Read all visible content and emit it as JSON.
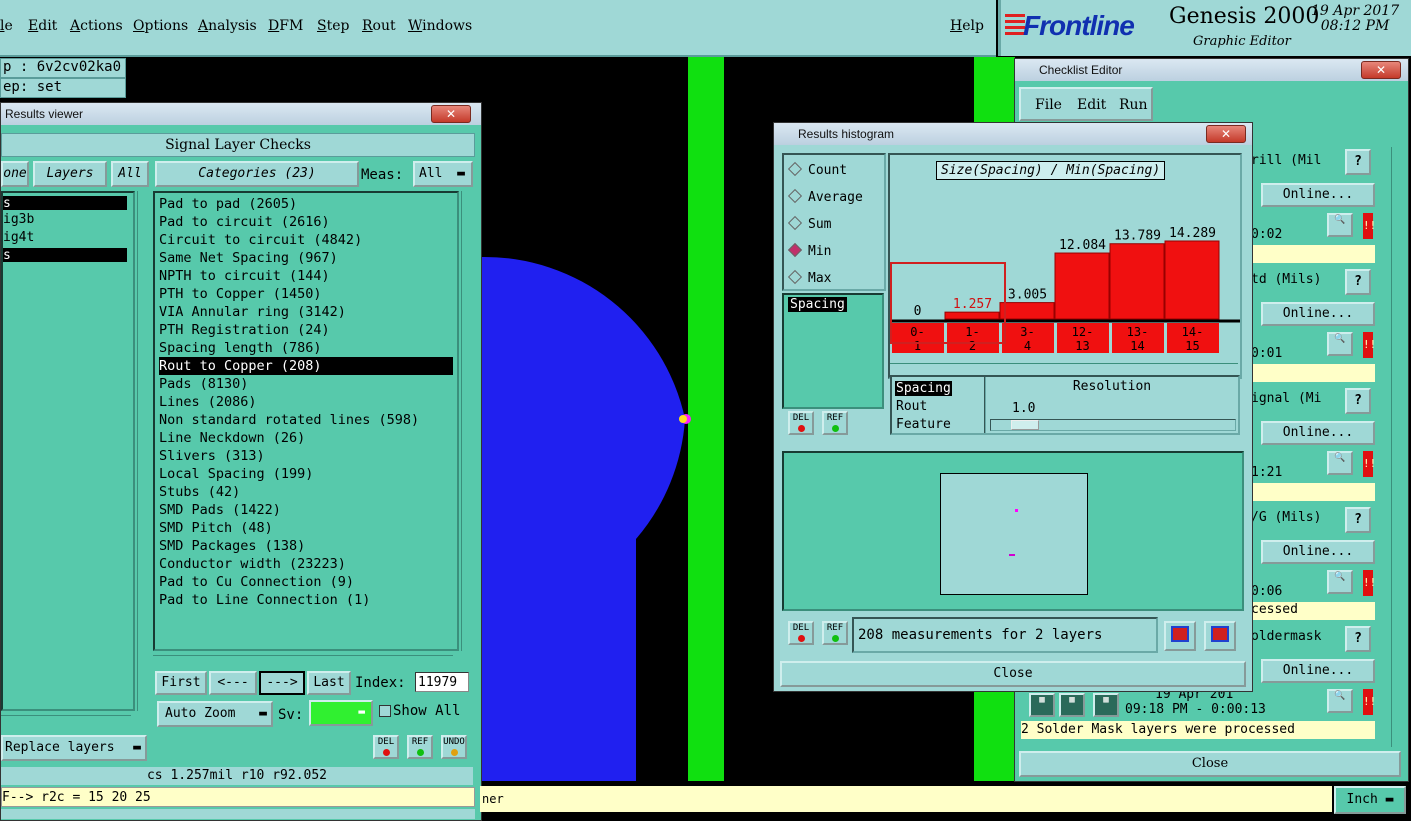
{
  "menu": [
    "le",
    "Edit",
    "Actions",
    "Options",
    "Analysis",
    "DFM",
    "Step",
    "Rout",
    "Windows"
  ],
  "help": "Help",
  "brand": {
    "logo": "Frontline",
    "product": "Genesis 2000",
    "subtitle": "Graphic Editor",
    "date": "19 Apr 2017",
    "time": "08:12 PM"
  },
  "job": {
    "job_line": "p : 6v2cv02ka0",
    "step_line": "ep: set"
  },
  "results_viewer": {
    "title": "Results viewer",
    "heading": "Signal Layer Checks",
    "tab_none": "one",
    "tab_layers": "Layers",
    "tab_all": "All",
    "categories_label": "Categories (23)",
    "meas_label": "Meas:",
    "meas_value": "All",
    "layers": [
      "s",
      "ig3b",
      "ig4t",
      "s"
    ],
    "categories": [
      "Pad to pad (2605)",
      "Pad to circuit (2616)",
      "Circuit to circuit (4842)",
      "Same Net Spacing (967)",
      "NPTH to circuit (144)",
      "PTH to Copper (1450)",
      "VIA Annular ring (3142)",
      "PTH Registration (24)",
      "Spacing length (786)",
      "Rout to Copper (208)",
      "Pads (8130)",
      "Lines (2086)",
      "Non standard rotated lines (598)",
      "Line Neckdown (26)",
      "Slivers (313)",
      "Local Spacing (199)",
      "Stubs (42)",
      "SMD Pads (1422)",
      "SMD Pitch (48)",
      "SMD Packages (138)",
      "Conductor width (23223)",
      "Pad to Cu Connection (9)",
      "Pad to Line Connection (1)"
    ],
    "selected_index": 9,
    "nav": {
      "first": "First",
      "prev": "<---",
      "next": "--->",
      "last": "Last",
      "index_label": "Index:",
      "index_value": "11979"
    },
    "zoom": "Auto Zoom",
    "sv_label": "Sv:",
    "show_all": "Show All",
    "replace_layers": "Replace layers",
    "status": "cs 1.257mil  r10  r92.052",
    "command": "F--> r2c = 15 20 25",
    "del": "DEL",
    "ref": "REF",
    "undo": "UNDO"
  },
  "histogram": {
    "title": "Results histogram",
    "modes": [
      "Count",
      "Average",
      "Sum",
      "Min",
      "Max"
    ],
    "selected_mode": "Min",
    "list_item": "Spacing",
    "chart_title": "Size(Spacing) / Min(Spacing)",
    "chart_data": {
      "type": "bar",
      "title": "Size(Spacing) / Min(Spacing)",
      "categories": [
        "0-1",
        "1-2",
        "3-4",
        "12-13",
        "13-14",
        "14-15"
      ],
      "values": [
        0,
        1.257,
        3.005,
        12.084,
        13.789,
        14.289
      ],
      "labels": [
        "0",
        "1.257",
        "3.005",
        "12.084",
        "13.789",
        "14.289"
      ],
      "ylim": [
        0,
        14.289
      ]
    },
    "bar_color": "#f01010",
    "filter_items": [
      "Spacing",
      "Rout",
      "Feature"
    ],
    "resolution_label": "Resolution",
    "resolution_value": "1.0",
    "measurements": "208 measurements for 2 layers",
    "close": "Close",
    "del": "DEL",
    "ref": "REF"
  },
  "checklist": {
    "title": "Checklist Editor",
    "menu": [
      "File",
      "Edit",
      "Run"
    ],
    "rows": [
      {
        "label": "rill (Mil",
        "online": "Online...",
        "time": "0:02",
        "note": ""
      },
      {
        "label": "td (Mils)",
        "online": "Online...",
        "time": "0:01",
        "note": ""
      },
      {
        "label": "ignal (Mi",
        "online": "Online...",
        "time": "1:21",
        "note": ""
      },
      {
        "label": "/G (Mils)",
        "online": "Online...",
        "time": "0:06",
        "note": "cessed"
      },
      {
        "label": "oldermask",
        "online": "Online...",
        "time": "09:18 PM - 0:00:13",
        "note": "2 Solder Mask layers were processed"
      }
    ],
    "partial_date": "19 Apr 201",
    "help_q": "?",
    "close": "Close"
  },
  "bottom": {
    "corner_text": "ner",
    "units": "Inch"
  }
}
